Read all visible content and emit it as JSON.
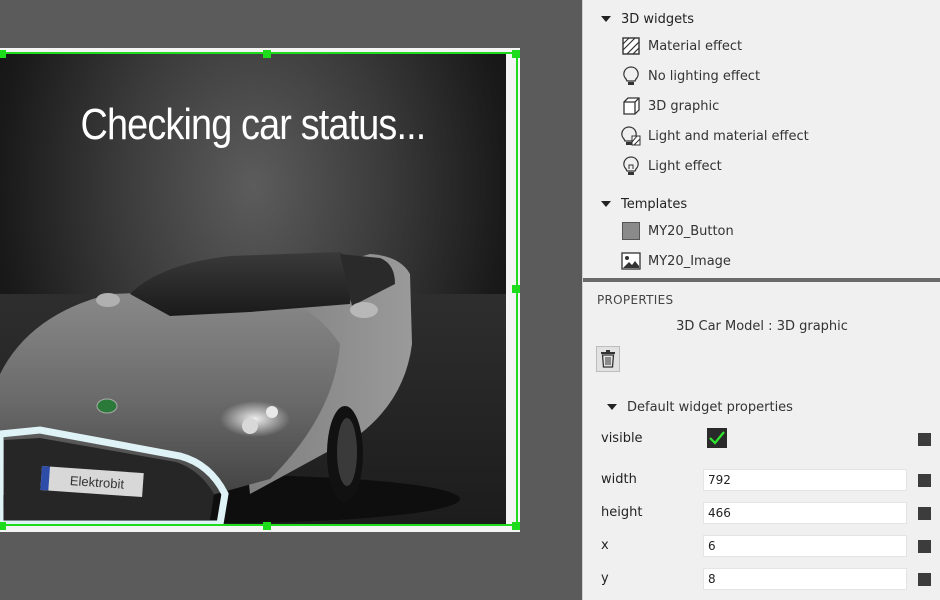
{
  "canvas": {
    "title": "Checking car status...",
    "plate_text": "Elektrobit"
  },
  "widget_tree": {
    "groups": [
      {
        "label": "3D widgets",
        "items": [
          {
            "label": "Material effect",
            "icon": "material-effect-icon"
          },
          {
            "label": "No lighting effect",
            "icon": "bulb-off-icon"
          },
          {
            "label": "3D graphic",
            "icon": "cube-icon"
          },
          {
            "label": "Light and material effect",
            "icon": "bulb-material-icon"
          },
          {
            "label": "Light effect",
            "icon": "bulb-icon"
          }
        ]
      },
      {
        "label": "Templates",
        "items": [
          {
            "label": "MY20_Button",
            "icon": "button-template-icon"
          },
          {
            "label": "MY20_Image",
            "icon": "image-template-icon"
          }
        ]
      }
    ]
  },
  "properties": {
    "header": "PROPERTIES",
    "subtitle": "3D Car Model : 3D graphic",
    "section_label": "Default widget properties",
    "rows": [
      {
        "label": "visible",
        "value": true
      },
      {
        "label": "width",
        "value": "792"
      },
      {
        "label": "height",
        "value": "466"
      },
      {
        "label": "x",
        "value": "6"
      },
      {
        "label": "y",
        "value": "8"
      }
    ]
  },
  "colors": {
    "selection": "#1cdc1c",
    "check": "#2ee82e",
    "panel_bg": "#f0f0f0",
    "workspace_bg": "#5b5b5b"
  }
}
